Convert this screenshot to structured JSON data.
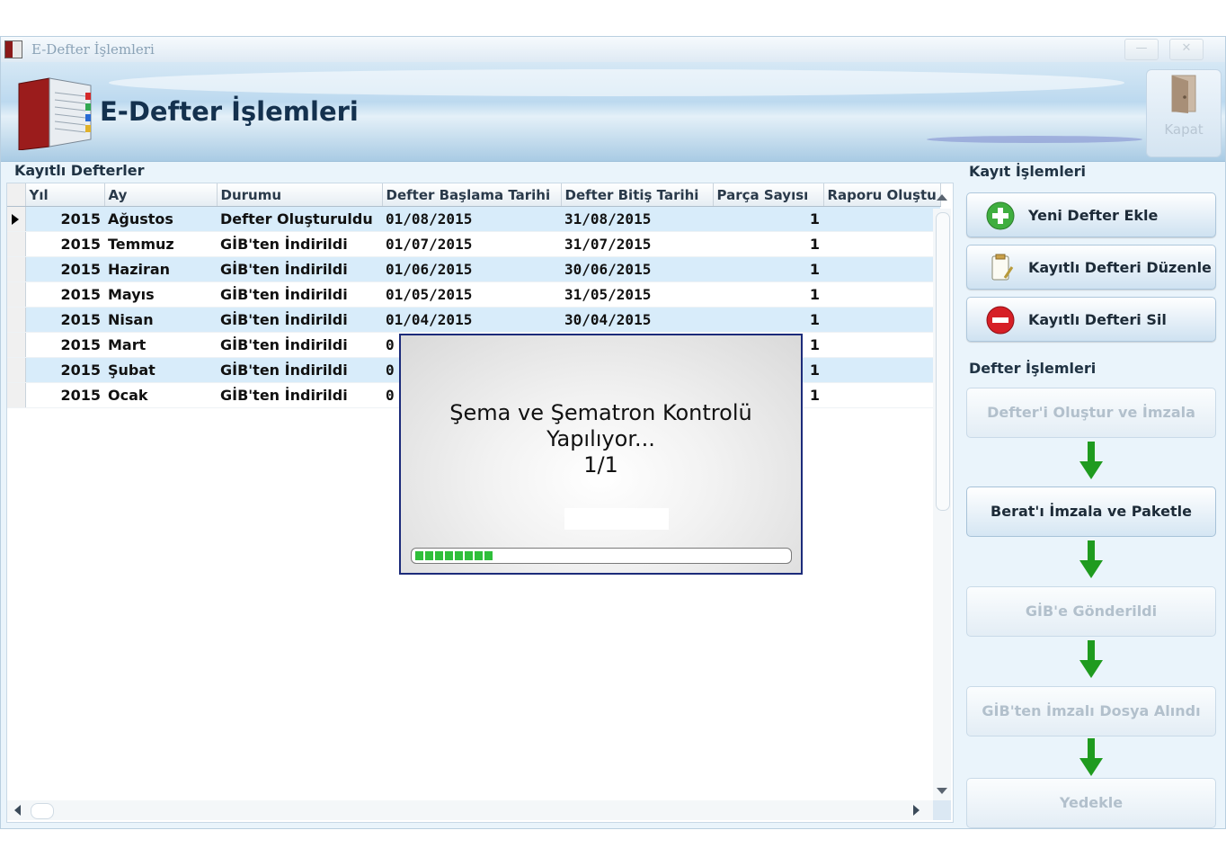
{
  "window": {
    "title": "E-Defter İşlemleri",
    "minimize": "—",
    "close": "✕"
  },
  "banner": {
    "title": "E-Defter İşlemleri",
    "close_label": "Kapat"
  },
  "grid": {
    "group_title": "Kayıtlı Defterler",
    "columns": [
      "Yıl",
      "Ay",
      "Durumu",
      "Defter Başlama Tarihi",
      "Defter Bitiş Tarihi",
      "Parça Sayısı",
      "Raporu Oluştu"
    ],
    "rows": [
      {
        "year": "2015",
        "month": "Ağustos",
        "status": "Defter Oluşturuldu",
        "start": "01/08/2015",
        "end": "31/08/2015",
        "parts": "1",
        "report": ""
      },
      {
        "year": "2015",
        "month": "Temmuz",
        "status": "GİB'ten İndirildi",
        "start": "01/07/2015",
        "end": "31/07/2015",
        "parts": "1",
        "report": ""
      },
      {
        "year": "2015",
        "month": "Haziran",
        "status": "GİB'ten İndirildi",
        "start": "01/06/2015",
        "end": "30/06/2015",
        "parts": "1",
        "report": ""
      },
      {
        "year": "2015",
        "month": "Mayıs",
        "status": "GİB'ten İndirildi",
        "start": "01/05/2015",
        "end": "31/05/2015",
        "parts": "1",
        "report": ""
      },
      {
        "year": "2015",
        "month": "Nisan",
        "status": "GİB'ten İndirildi",
        "start": "01/04/2015",
        "end": "30/04/2015",
        "parts": "1",
        "report": ""
      },
      {
        "year": "2015",
        "month": "Mart",
        "status": "GİB'ten İndirildi",
        "start": "0",
        "end": "",
        "parts": "1",
        "report": ""
      },
      {
        "year": "2015",
        "month": "Şubat",
        "status": "GİB'ten İndirildi",
        "start": "0",
        "end": "",
        "parts": "1",
        "report": ""
      },
      {
        "year": "2015",
        "month": "Ocak",
        "status": "GİB'ten İndirildi",
        "start": "0",
        "end": "",
        "parts": "1",
        "report": ""
      }
    ]
  },
  "record_ops": {
    "group_title": "Kayıt İşlemleri",
    "add": "Yeni Defter Ekle",
    "edit": "Kayıtlı Defteri Düzenle",
    "delete": "Kayıtlı Defteri Sil"
  },
  "ledger_ops": {
    "group_title": "Defter İşlemleri",
    "steps": [
      {
        "label": "Defter'i Oluştur ve İmzala",
        "enabled": false
      },
      {
        "label": "Berat'ı İmzala ve Paketle",
        "enabled": true
      },
      {
        "label": "GİB'e Gönderildi",
        "enabled": false
      },
      {
        "label": "GİB'ten İmzalı Dosya Alındı",
        "enabled": false
      },
      {
        "label": "Yedekle",
        "enabled": false
      }
    ]
  },
  "dialog": {
    "line1": "Şema ve Şematron Kontrolü",
    "line2": "Yapılıyor...",
    "line3": "1/1",
    "progress": 0.21
  },
  "colors": {
    "row_alt": "#d8ecfa",
    "progress_green": "#2fbf3a",
    "dialog_border": "#1c2b7a",
    "delete_red": "#d61f26",
    "add_green": "#3fae3f"
  }
}
